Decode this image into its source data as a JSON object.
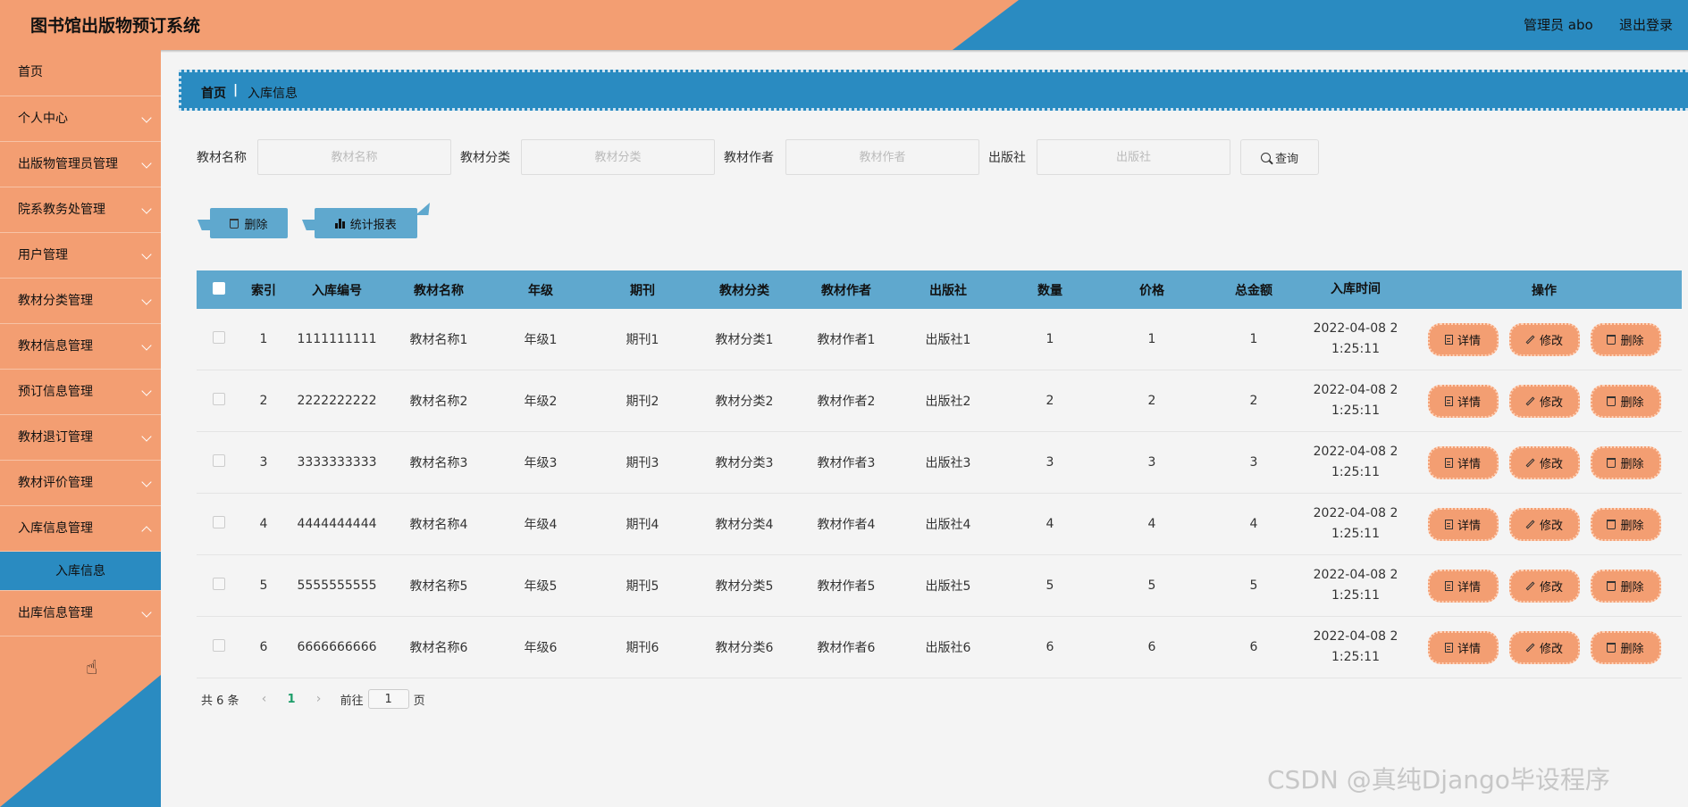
{
  "header": {
    "title": "图书馆出版物预订系统",
    "user": "管理员 abo",
    "logout": "退出登录"
  },
  "sidebar": {
    "items": [
      {
        "label": "首页"
      },
      {
        "label": "个人中心"
      },
      {
        "label": "出版物管理员管理"
      },
      {
        "label": "院系教务处管理"
      },
      {
        "label": "用户管理"
      },
      {
        "label": "教材分类管理"
      },
      {
        "label": "教材信息管理"
      },
      {
        "label": "预订信息管理"
      },
      {
        "label": "教材退订管理"
      },
      {
        "label": "教材评价管理"
      },
      {
        "label": "入库信息管理"
      },
      {
        "label": "出库信息管理"
      }
    ],
    "sub_item": "入库信息"
  },
  "breadcrumb": {
    "home": "首页",
    "sep": "|",
    "current": "入库信息"
  },
  "search": {
    "name_label": "教材名称",
    "name_placeholder": "教材名称",
    "category_label": "教材分类",
    "category_placeholder": "教材分类",
    "author_label": "教材作者",
    "author_placeholder": "教材作者",
    "publisher_label": "出版社",
    "publisher_placeholder": "出版社",
    "query_label": "查询"
  },
  "actions": {
    "delete_label": "删除",
    "stats_label": "统计报表"
  },
  "table": {
    "headers": {
      "index": "索引",
      "no": "入库编号",
      "name": "教材名称",
      "grade": "年级",
      "periodical": "期刊",
      "category": "教材分类",
      "author": "教材作者",
      "publisher": "出版社",
      "quantity": "数量",
      "price": "价格",
      "total": "总金额",
      "time": "入库时间",
      "ops": "操作"
    },
    "rows": [
      {
        "index": "1",
        "no": "1111111111",
        "name": "教材名称1",
        "grade": "年级1",
        "periodical": "期刊1",
        "category": "教材分类1",
        "author": "教材作者1",
        "publisher": "出版社1",
        "quantity": "1",
        "price": "1",
        "total": "1",
        "time_line1": "2022-04-08 2",
        "time_line2": "1:25:11"
      },
      {
        "index": "2",
        "no": "2222222222",
        "name": "教材名称2",
        "grade": "年级2",
        "periodical": "期刊2",
        "category": "教材分类2",
        "author": "教材作者2",
        "publisher": "出版社2",
        "quantity": "2",
        "price": "2",
        "total": "2",
        "time_line1": "2022-04-08 2",
        "time_line2": "1:25:11"
      },
      {
        "index": "3",
        "no": "3333333333",
        "name": "教材名称3",
        "grade": "年级3",
        "periodical": "期刊3",
        "category": "教材分类3",
        "author": "教材作者3",
        "publisher": "出版社3",
        "quantity": "3",
        "price": "3",
        "total": "3",
        "time_line1": "2022-04-08 2",
        "time_line2": "1:25:11"
      },
      {
        "index": "4",
        "no": "4444444444",
        "name": "教材名称4",
        "grade": "年级4",
        "periodical": "期刊4",
        "category": "教材分类4",
        "author": "教材作者4",
        "publisher": "出版社4",
        "quantity": "4",
        "price": "4",
        "total": "4",
        "time_line1": "2022-04-08 2",
        "time_line2": "1:25:11"
      },
      {
        "index": "5",
        "no": "5555555555",
        "name": "教材名称5",
        "grade": "年级5",
        "periodical": "期刊5",
        "category": "教材分类5",
        "author": "教材作者5",
        "publisher": "出版社5",
        "quantity": "5",
        "price": "5",
        "total": "5",
        "time_line1": "2022-04-08 2",
        "time_line2": "1:25:11"
      },
      {
        "index": "6",
        "no": "6666666666",
        "name": "教材名称6",
        "grade": "年级6",
        "periodical": "期刊6",
        "category": "教材分类6",
        "author": "教材作者6",
        "publisher": "出版社6",
        "quantity": "6",
        "price": "6",
        "total": "6",
        "time_line1": "2022-04-08 2",
        "time_line2": "1:25:11"
      }
    ],
    "op_labels": {
      "detail": "详情",
      "edit": "修改",
      "delete": "删除"
    }
  },
  "pager": {
    "total": "共 6 条",
    "prev": "‹",
    "page": "1",
    "next": "›",
    "goto_prefix": "前往",
    "goto_value": "1",
    "goto_suffix": "页"
  },
  "watermark": "CSDN @真纯Django毕设程序",
  "colors": {
    "accent_orange": "#f39e72",
    "accent_blue": "#2a8bc1",
    "table_header_blue": "#5fa8ce",
    "page_active": "#1e9e6a"
  }
}
